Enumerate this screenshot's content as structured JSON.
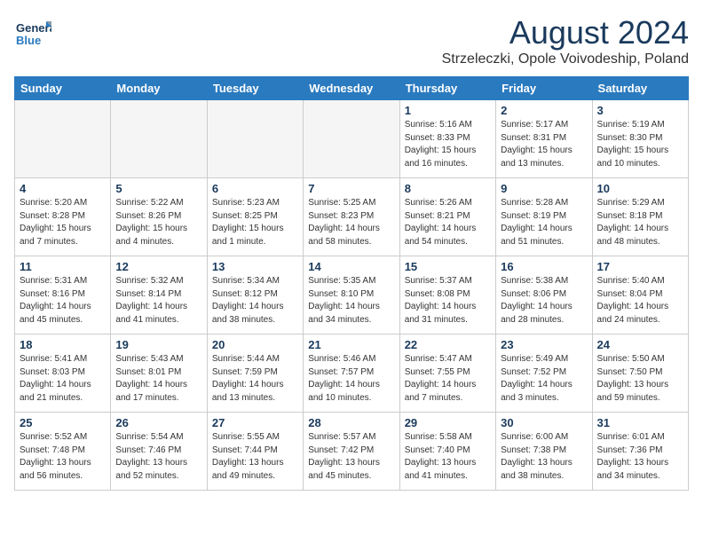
{
  "header": {
    "logo_general": "General",
    "logo_blue": "Blue",
    "month_year": "August 2024",
    "location": "Strzeleczki, Opole Voivodeship, Poland"
  },
  "weekdays": [
    "Sunday",
    "Monday",
    "Tuesday",
    "Wednesday",
    "Thursday",
    "Friday",
    "Saturday"
  ],
  "weeks": [
    [
      {
        "day": "",
        "info": ""
      },
      {
        "day": "",
        "info": ""
      },
      {
        "day": "",
        "info": ""
      },
      {
        "day": "",
        "info": ""
      },
      {
        "day": "1",
        "info": "Sunrise: 5:16 AM\nSunset: 8:33 PM\nDaylight: 15 hours\nand 16 minutes."
      },
      {
        "day": "2",
        "info": "Sunrise: 5:17 AM\nSunset: 8:31 PM\nDaylight: 15 hours\nand 13 minutes."
      },
      {
        "day": "3",
        "info": "Sunrise: 5:19 AM\nSunset: 8:30 PM\nDaylight: 15 hours\nand 10 minutes."
      }
    ],
    [
      {
        "day": "4",
        "info": "Sunrise: 5:20 AM\nSunset: 8:28 PM\nDaylight: 15 hours\nand 7 minutes."
      },
      {
        "day": "5",
        "info": "Sunrise: 5:22 AM\nSunset: 8:26 PM\nDaylight: 15 hours\nand 4 minutes."
      },
      {
        "day": "6",
        "info": "Sunrise: 5:23 AM\nSunset: 8:25 PM\nDaylight: 15 hours\nand 1 minute."
      },
      {
        "day": "7",
        "info": "Sunrise: 5:25 AM\nSunset: 8:23 PM\nDaylight: 14 hours\nand 58 minutes."
      },
      {
        "day": "8",
        "info": "Sunrise: 5:26 AM\nSunset: 8:21 PM\nDaylight: 14 hours\nand 54 minutes."
      },
      {
        "day": "9",
        "info": "Sunrise: 5:28 AM\nSunset: 8:19 PM\nDaylight: 14 hours\nand 51 minutes."
      },
      {
        "day": "10",
        "info": "Sunrise: 5:29 AM\nSunset: 8:18 PM\nDaylight: 14 hours\nand 48 minutes."
      }
    ],
    [
      {
        "day": "11",
        "info": "Sunrise: 5:31 AM\nSunset: 8:16 PM\nDaylight: 14 hours\nand 45 minutes."
      },
      {
        "day": "12",
        "info": "Sunrise: 5:32 AM\nSunset: 8:14 PM\nDaylight: 14 hours\nand 41 minutes."
      },
      {
        "day": "13",
        "info": "Sunrise: 5:34 AM\nSunset: 8:12 PM\nDaylight: 14 hours\nand 38 minutes."
      },
      {
        "day": "14",
        "info": "Sunrise: 5:35 AM\nSunset: 8:10 PM\nDaylight: 14 hours\nand 34 minutes."
      },
      {
        "day": "15",
        "info": "Sunrise: 5:37 AM\nSunset: 8:08 PM\nDaylight: 14 hours\nand 31 minutes."
      },
      {
        "day": "16",
        "info": "Sunrise: 5:38 AM\nSunset: 8:06 PM\nDaylight: 14 hours\nand 28 minutes."
      },
      {
        "day": "17",
        "info": "Sunrise: 5:40 AM\nSunset: 8:04 PM\nDaylight: 14 hours\nand 24 minutes."
      }
    ],
    [
      {
        "day": "18",
        "info": "Sunrise: 5:41 AM\nSunset: 8:03 PM\nDaylight: 14 hours\nand 21 minutes."
      },
      {
        "day": "19",
        "info": "Sunrise: 5:43 AM\nSunset: 8:01 PM\nDaylight: 14 hours\nand 17 minutes."
      },
      {
        "day": "20",
        "info": "Sunrise: 5:44 AM\nSunset: 7:59 PM\nDaylight: 14 hours\nand 13 minutes."
      },
      {
        "day": "21",
        "info": "Sunrise: 5:46 AM\nSunset: 7:57 PM\nDaylight: 14 hours\nand 10 minutes."
      },
      {
        "day": "22",
        "info": "Sunrise: 5:47 AM\nSunset: 7:55 PM\nDaylight: 14 hours\nand 7 minutes."
      },
      {
        "day": "23",
        "info": "Sunrise: 5:49 AM\nSunset: 7:52 PM\nDaylight: 14 hours\nand 3 minutes."
      },
      {
        "day": "24",
        "info": "Sunrise: 5:50 AM\nSunset: 7:50 PM\nDaylight: 13 hours\nand 59 minutes."
      }
    ],
    [
      {
        "day": "25",
        "info": "Sunrise: 5:52 AM\nSunset: 7:48 PM\nDaylight: 13 hours\nand 56 minutes."
      },
      {
        "day": "26",
        "info": "Sunrise: 5:54 AM\nSunset: 7:46 PM\nDaylight: 13 hours\nand 52 minutes."
      },
      {
        "day": "27",
        "info": "Sunrise: 5:55 AM\nSunset: 7:44 PM\nDaylight: 13 hours\nand 49 minutes."
      },
      {
        "day": "28",
        "info": "Sunrise: 5:57 AM\nSunset: 7:42 PM\nDaylight: 13 hours\nand 45 minutes."
      },
      {
        "day": "29",
        "info": "Sunrise: 5:58 AM\nSunset: 7:40 PM\nDaylight: 13 hours\nand 41 minutes."
      },
      {
        "day": "30",
        "info": "Sunrise: 6:00 AM\nSunset: 7:38 PM\nDaylight: 13 hours\nand 38 minutes."
      },
      {
        "day": "31",
        "info": "Sunrise: 6:01 AM\nSunset: 7:36 PM\nDaylight: 13 hours\nand 34 minutes."
      }
    ]
  ]
}
